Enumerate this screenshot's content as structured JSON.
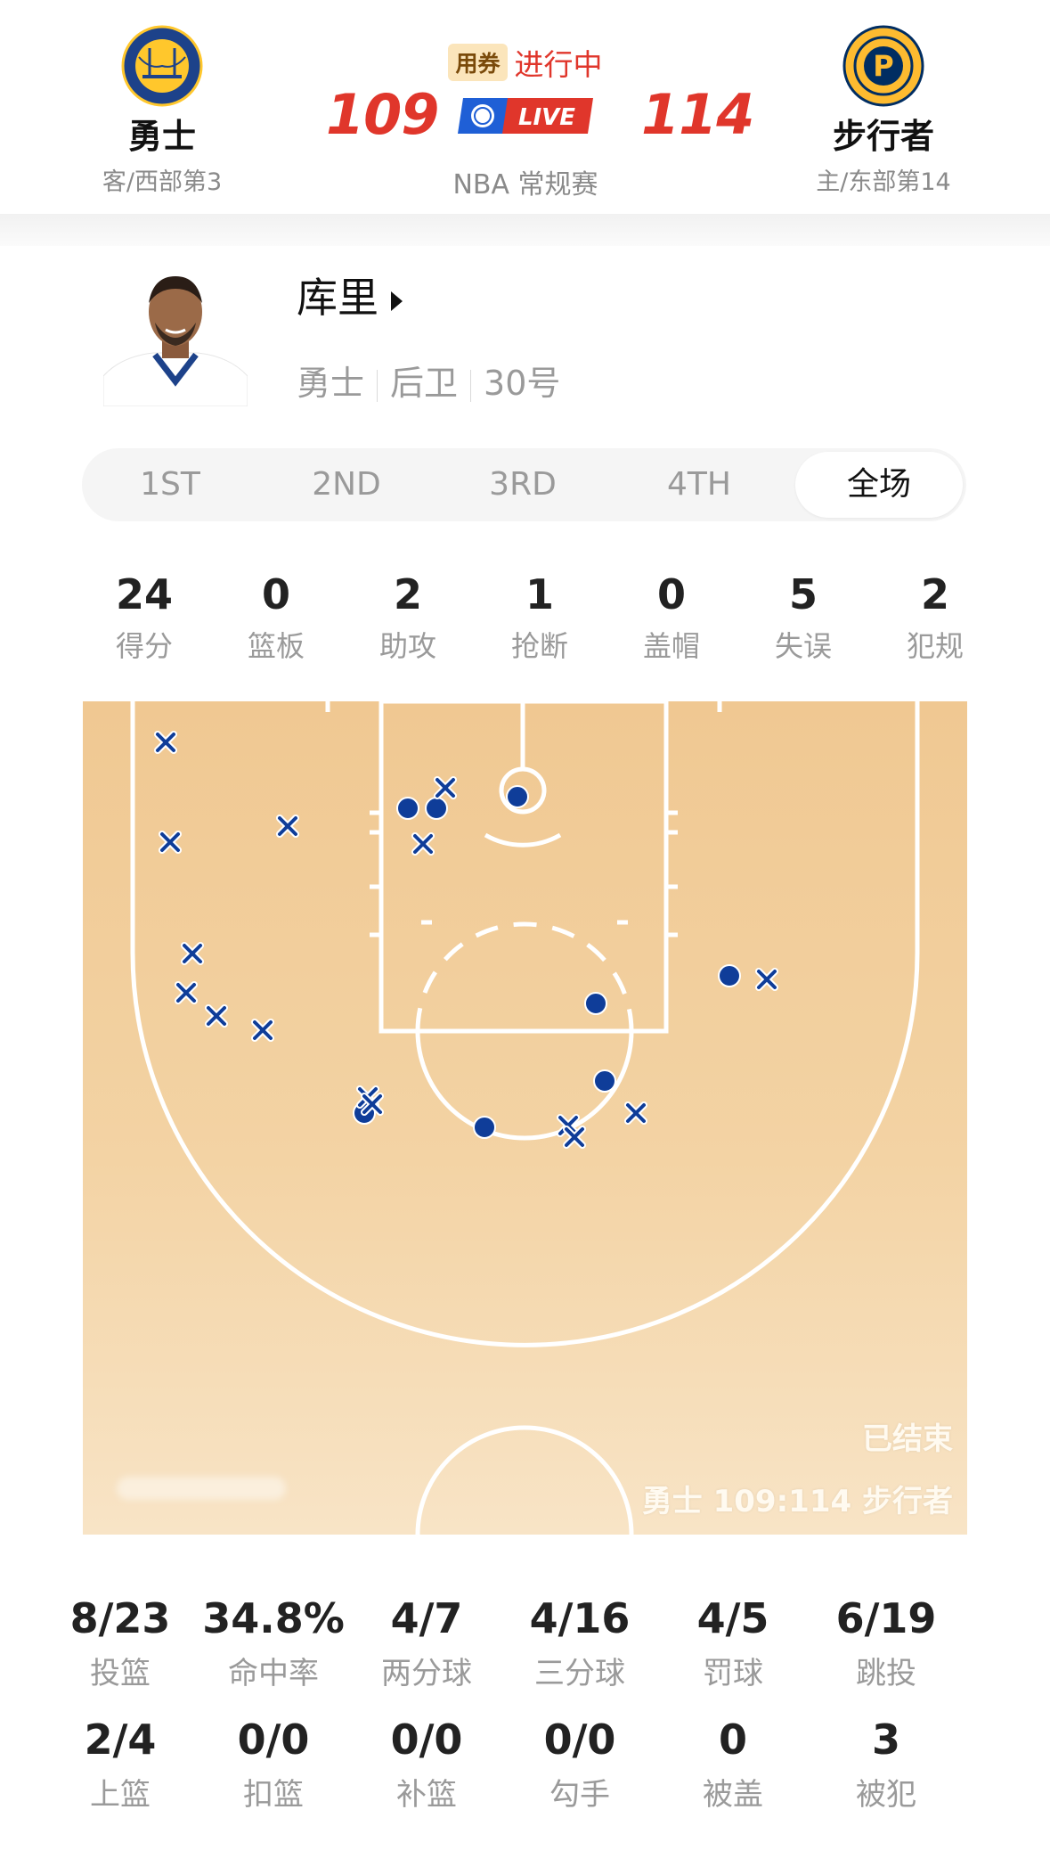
{
  "header": {
    "away": {
      "name": "勇士",
      "sub": "客/西部第3",
      "logo_text_top": "GOLDEN STATE",
      "logo_text_bottom": "WARRIORS"
    },
    "home": {
      "name": "步行者",
      "sub": "主/东部第14",
      "logo_text": "INDIANA PACERS",
      "logo_letter": "P"
    },
    "coupon_label": "用券",
    "status": "进行中",
    "away_score": "109",
    "home_score": "114",
    "live_label": "LIVE",
    "league": "NBA 常规赛"
  },
  "player": {
    "name": "库里",
    "team": "勇士",
    "position": "后卫",
    "number": "30号"
  },
  "tabs": [
    "1ST",
    "2ND",
    "3RD",
    "4TH",
    "全场"
  ],
  "active_tab": "全场",
  "stats": [
    {
      "value": "24",
      "label": "得分"
    },
    {
      "value": "0",
      "label": "篮板"
    },
    {
      "value": "2",
      "label": "助攻"
    },
    {
      "value": "1",
      "label": "抢断"
    },
    {
      "value": "0",
      "label": "盖帽"
    },
    {
      "value": "5",
      "label": "失误"
    },
    {
      "value": "2",
      "label": "犯规"
    }
  ],
  "court": {
    "ended_label": "已结束",
    "final_score_text": "勇士 109:114 步行者",
    "colors": {
      "made": "#0f3d99",
      "missed": "#0f3d99",
      "floor": "#f2cf9c",
      "lines": "#ffffff"
    }
  },
  "shooting": [
    [
      {
        "value": "8/23",
        "label": "投篮"
      },
      {
        "value": "34.8%",
        "label": "命中率"
      },
      {
        "value": "4/7",
        "label": "两分球"
      },
      {
        "value": "4/16",
        "label": "三分球"
      },
      {
        "value": "4/5",
        "label": "罚球"
      },
      {
        "value": "6/19",
        "label": "跳投"
      }
    ],
    [
      {
        "value": "2/4",
        "label": "上篮"
      },
      {
        "value": "0/0",
        "label": "扣篮"
      },
      {
        "value": "0/0",
        "label": "补篮"
      },
      {
        "value": "0/0",
        "label": "勾手"
      },
      {
        "value": "0",
        "label": "被盖"
      },
      {
        "value": "3",
        "label": "被犯"
      }
    ]
  ],
  "colors": {
    "accent_red": "#e0362b",
    "live_blue": "#1f5fd6",
    "coupon_bg": "#fbe5bb"
  }
}
